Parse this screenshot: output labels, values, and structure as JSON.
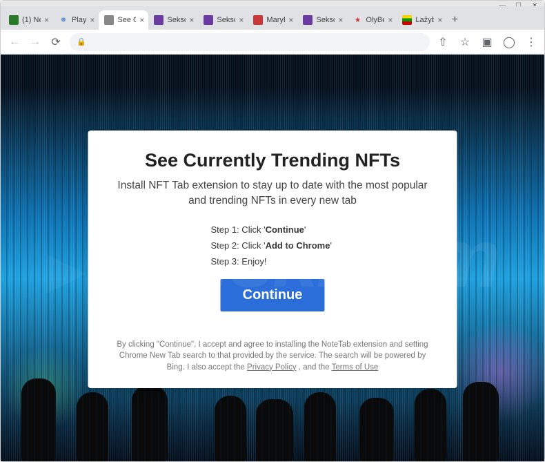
{
  "window": {
    "minimize": "—",
    "maximize": "☐",
    "close": "✕"
  },
  "tabs": [
    {
      "title": "(1) Ne",
      "fav": "fav-green"
    },
    {
      "title": "Play",
      "fav": "fav-blue"
    },
    {
      "title": "See C",
      "fav": "fav-gray",
      "active": true
    },
    {
      "title": "Sekso",
      "fav": "fav-purple"
    },
    {
      "title": "Sekso",
      "fav": "fav-purple"
    },
    {
      "title": "MaryE",
      "fav": "fav-red"
    },
    {
      "title": "Sekso",
      "fav": "fav-purple"
    },
    {
      "title": "OlyBe",
      "fav": "fav-star"
    },
    {
      "title": "Lažyb",
      "fav": "fav-flag"
    }
  ],
  "newtab": "+",
  "nav": {
    "back": "←",
    "forward": "→",
    "reload": "⟳"
  },
  "address": {
    "lock": "🔒",
    "value": ""
  },
  "toolbar_icons": {
    "share": "⇧",
    "star": "☆",
    "ext": "▣",
    "profile": "◯",
    "menu": "⋮"
  },
  "page": {
    "title": "See Currently Trending NFTs",
    "subtitle": "Install NFT Tab extension to stay up to date with the most popular and trending NFTs in every new tab",
    "step1_a": "Step 1: Click '",
    "step1_b": "Continue",
    "step1_c": "'",
    "step2_a": "Step 2: Click '",
    "step2_b": "Add to Chrome",
    "step2_c": "'",
    "step3": "Step 3: Enjoy!",
    "continue": "Continue",
    "legal_a": "By clicking \"Continue\", I accept and agree to installing the NoteTab extension and setting Chrome New Tab search to that provided by the service. The search will be powered by Bing. I also accept the ",
    "legal_pp": "Privacy Policy",
    "legal_b": " , and the ",
    "legal_tou": "Terms of Use"
  },
  "watermark": "pcrisk.com"
}
